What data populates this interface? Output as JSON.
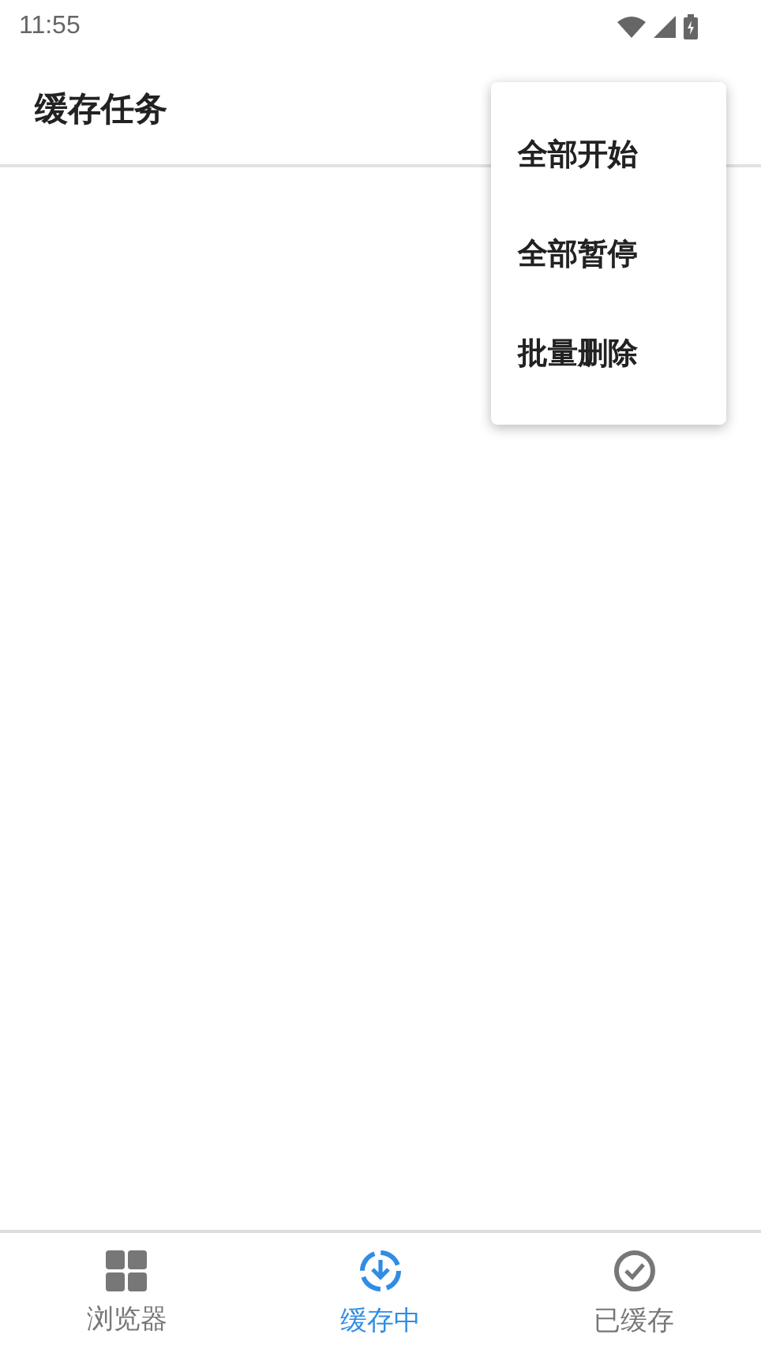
{
  "status_bar": {
    "time": "11:55"
  },
  "app_bar": {
    "title": "缓存任务"
  },
  "menu": {
    "items": [
      {
        "label": "全部开始"
      },
      {
        "label": "全部暂停"
      },
      {
        "label": "批量删除"
      }
    ]
  },
  "bottom_nav": [
    {
      "label": "浏览器",
      "kind": "grid",
      "selected": false
    },
    {
      "label": "缓存中",
      "kind": "download",
      "selected": true
    },
    {
      "label": "已缓存",
      "kind": "done",
      "selected": false
    }
  ]
}
